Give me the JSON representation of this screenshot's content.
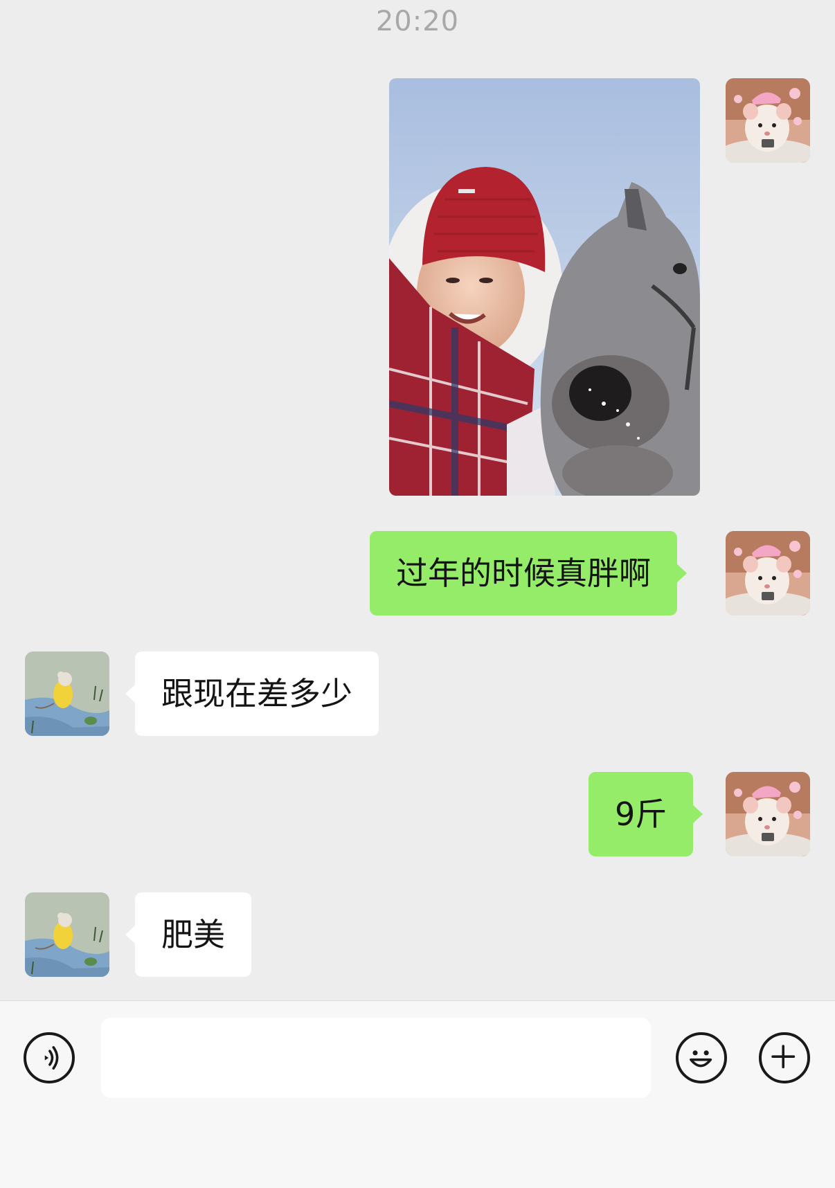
{
  "chat": {
    "timestamp": "20:20",
    "messages": [
      {
        "side": "mine",
        "type": "image",
        "image_desc": "Selfie of a girl in a red knit hat and plaid scarf next to a grey horse against a blue sky"
      },
      {
        "side": "mine",
        "type": "text",
        "text": "过年的时候真胖啊"
      },
      {
        "side": "theirs",
        "type": "text",
        "text": "跟现在差多少"
      },
      {
        "side": "mine",
        "type": "text",
        "text": "9斤"
      },
      {
        "side": "theirs",
        "type": "text",
        "text": "肥美"
      }
    ]
  },
  "input_bar": {
    "placeholder": "",
    "icons": [
      "voice-icon",
      "emoji-icon",
      "plus-icon"
    ]
  },
  "colors": {
    "background": "#ededed",
    "mine_bubble": "#95ec69",
    "theirs_bubble": "#ffffff",
    "timestamp": "#a8a8a8"
  }
}
